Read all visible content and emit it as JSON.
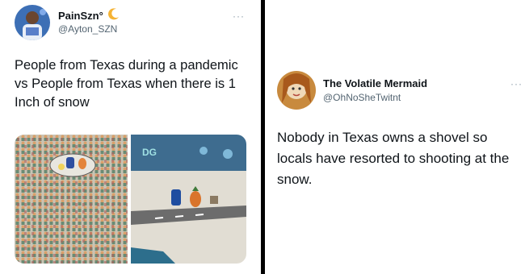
{
  "left_tweet": {
    "display_name": "PainSzn°",
    "name_emoji": "moon-icon",
    "handle": "@Ayton_SZN",
    "more_label": "···",
    "text": "People from Texas during a pandemic vs People from Texas when there is 1 Inch of snow",
    "media": {
      "left_image": "crowded-crowd-image",
      "right_image": "empty-street-image",
      "sign_text": "DG"
    }
  },
  "right_tweet": {
    "display_name": "The Volatile Mermaid",
    "handle": "@OhNoSheTwitnt",
    "more_label": "···",
    "text": "Nobody in Texas owns a shovel so locals have resorted to shooting at the snow."
  },
  "colors": {
    "handle_gray": "#536471",
    "divider": "#000000",
    "moon_yellow": "#f5b335"
  }
}
